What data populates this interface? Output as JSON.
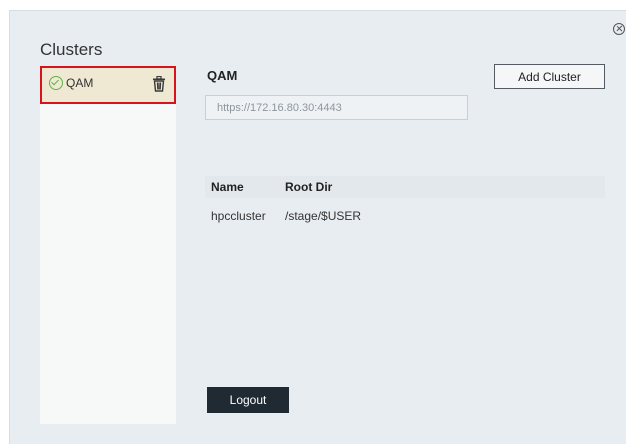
{
  "dialog": {
    "close_icon": "close-circle-icon"
  },
  "sidebar": {
    "title": "Clusters",
    "items": [
      {
        "label": "QAM",
        "status_icon": "check-circle-icon",
        "status_color": "#64b049",
        "delete_icon": "trash-icon",
        "selected": true
      }
    ]
  },
  "detail": {
    "title": "QAM",
    "url_value": "https://172.16.80.30:4443",
    "add_button_label": "Add Cluster"
  },
  "table": {
    "columns": [
      "Name",
      "Root Dir"
    ],
    "rows": [
      {
        "name": "hpccluster",
        "root_dir": "/stage/$USER"
      }
    ]
  },
  "footer": {
    "logout_label": "Logout"
  },
  "colors": {
    "selection_border": "#d7141b",
    "selection_background": "#efe8d2",
    "logout_background": "#1f2a33"
  }
}
